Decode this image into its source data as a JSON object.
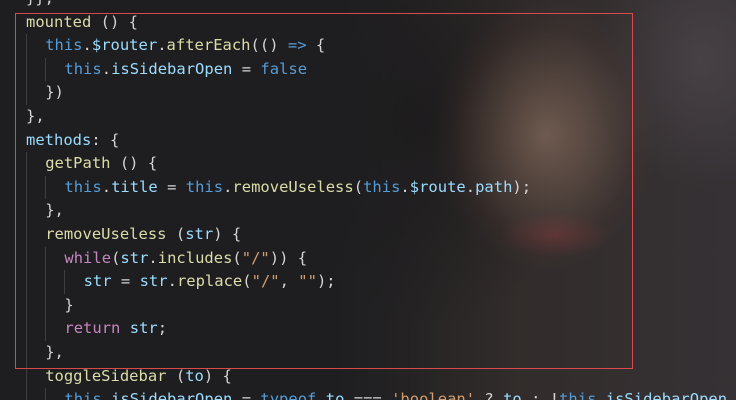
{
  "editor": {
    "selection_color": "#d94a4a",
    "lines": [
      {
        "text": "}},"
      },
      {
        "text": "mounted () {"
      },
      {
        "text": "this.$router.afterEach(() => {"
      },
      {
        "text": "this.isSidebarOpen = false"
      },
      {
        "text": "})"
      },
      {
        "text": "},"
      },
      {
        "text": "methods: {"
      },
      {
        "text": "getPath () {"
      },
      {
        "text": "this.title = this.removeUseless(this.$route.path);"
      },
      {
        "text": "},"
      },
      {
        "text": "removeUseless (str) {"
      },
      {
        "text": "while(str.includes(\"/\")) {"
      },
      {
        "text": "str = str.replace(\"/\", \"\");"
      },
      {
        "text": "}"
      },
      {
        "text": "return str;"
      },
      {
        "text": "},"
      },
      {
        "text": "toggleSidebar (to) {"
      },
      {
        "text": "this.isSidebarOpen = typeof to === 'boolean' ? to : !this.isSidebarOpen"
      }
    ]
  }
}
